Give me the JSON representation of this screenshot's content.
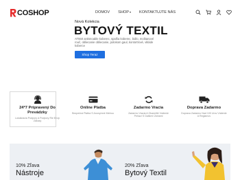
{
  "brand": {
    "name": "COSHOP",
    "accent": "#e52b2b"
  },
  "nav": {
    "items": [
      {
        "label": "DOMOV"
      },
      {
        "label": "SHOP"
      },
      {
        "label": "KONTAKTUJTE NÁS"
      }
    ]
  },
  "header_icons": [
    "search-icon",
    "cart-icon",
    "user-icon",
    "heart-icon"
  ],
  "hero": {
    "subtitle": "Nová Kolekcia",
    "title": "BYTOVÝ TEXTIL",
    "description": "AT550 antisnoable koberec, spalňa koberec, bidlo, molitanové rouč, obliecanie obliecanie, polokom gaul, kontortrové, vkláde koberce",
    "button_label": "Shop Teraz",
    "button_color": "#1f6fe0"
  },
  "features": [
    {
      "icon": "support-agent-icon",
      "title": "24*7 Pripravený Do Prevádzky",
      "desc": "Lokalizácia Podpory A Podpory Rie Bezp Zákazy"
    },
    {
      "icon": "credit-card-icon",
      "title": "Online Platba",
      "desc": "Bezpečná Platba S Anonymné Metrou"
    },
    {
      "icon": "refresh-icon",
      "title": "Zadarmo Vracia",
      "desc": "Zadarmo Vracia A Okamžité Vrátenie Peňazí S Dalšími Úlohami"
    },
    {
      "icon": "delivery-truck-icon",
      "title": "Doprava Zadarmo",
      "desc": "Doprava Zadarmo Nad 100 Urov Vrátenie A Reglamov"
    }
  ],
  "promo": [
    {
      "label": "10% Zľava",
      "title": "Nástroje"
    },
    {
      "label": "20% Zľava",
      "title": "Bytový Textil"
    }
  ]
}
